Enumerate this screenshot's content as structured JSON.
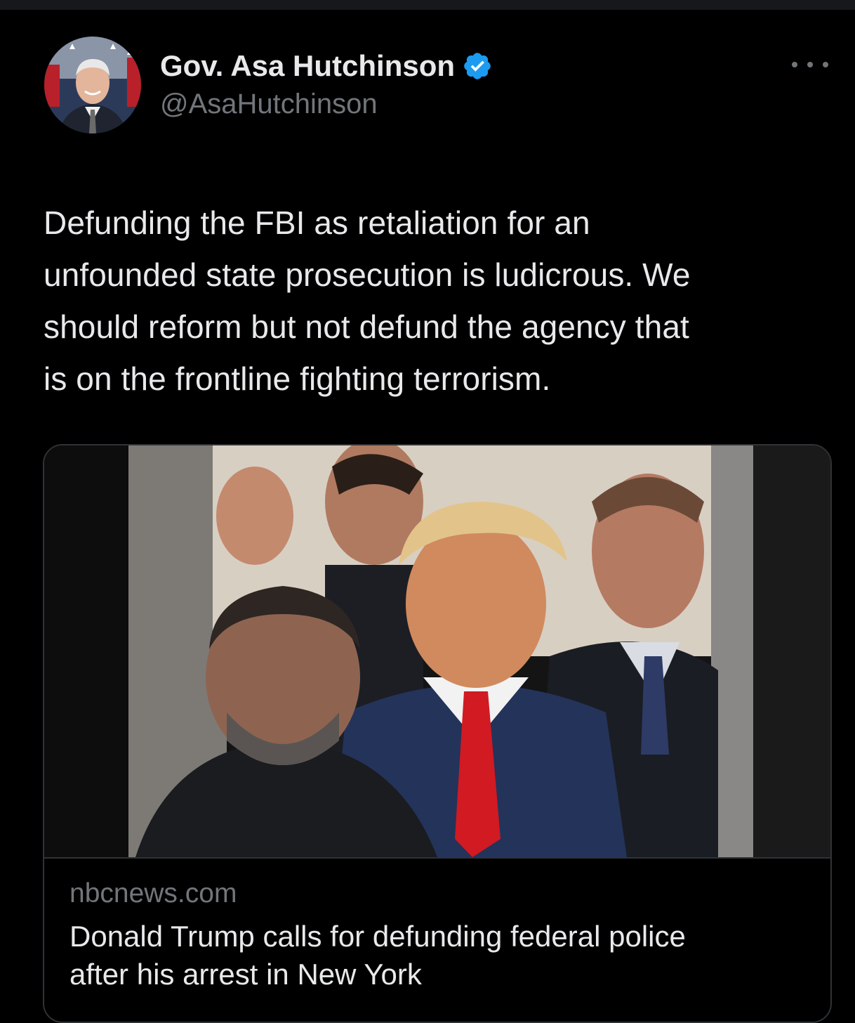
{
  "tweet": {
    "author": {
      "display_name": "Gov. Asa Hutchinson",
      "handle": "@AsaHutchinson",
      "verified": true,
      "avatar_icon": "profile-photo"
    },
    "more_icon": "more-horizontal-icon",
    "text": "Defunding the FBI as retaliation for an\nunfounded state prosecution is ludicrous.  We\nshould reform but not defund the agency that\nis on the frontline fighting terrorism.",
    "link_card": {
      "domain": "nbcnews.com",
      "title": "Donald Trump calls for defunding federal police\nafter his arrest in New York",
      "image_icon": "news-photo"
    }
  },
  "colors": {
    "background": "#000000",
    "text_primary": "#e7e9ea",
    "text_secondary": "#71767b",
    "verified_blue": "#1d9bf0",
    "border": "#2f3336"
  }
}
